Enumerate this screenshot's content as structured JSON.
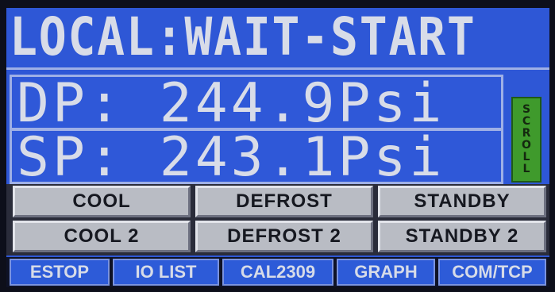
{
  "status": {
    "text": "LOCAL:WAIT-START"
  },
  "readings": {
    "dp": "DP: 244.9Psi",
    "sp": "SP: 243.1Psi"
  },
  "scroll": {
    "label": "SCROLL"
  },
  "modes": {
    "cool": "COOL",
    "defrost": "DEFROST",
    "standby": "STANDBY",
    "cool2": "COOL 2",
    "defrost2": "DEFROST 2",
    "standby2": "STANDBY 2"
  },
  "nav": {
    "estop": "ESTOP",
    "io_list": "IO LIST",
    "cal": "CAL2309",
    "graph": "GRAPH",
    "com": "COM/TCP"
  },
  "colors": {
    "screen_bg": "#2e57d6",
    "text": "#d8dce8",
    "scroll_green": "#3f9a2c",
    "button_gray": "#b9bcc4"
  }
}
